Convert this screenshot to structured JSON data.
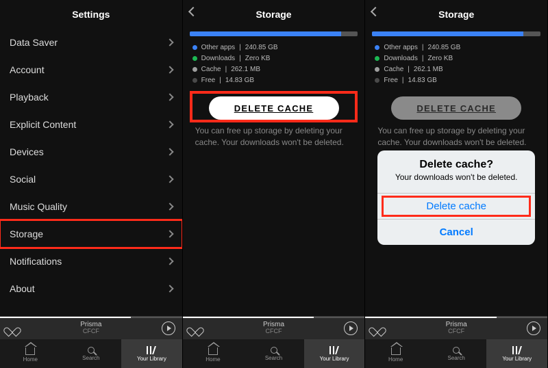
{
  "colors": {
    "highlight": "#ff2b1a",
    "link": "#007aff",
    "barBlue": "#3b82f6",
    "dotBlue": "#3b82f6",
    "dotGreen": "#1db954",
    "dotGray": "#9e9e9e",
    "dotDark": "#4a4a4a"
  },
  "settings": {
    "title": "Settings",
    "items": [
      {
        "label": "Data Saver"
      },
      {
        "label": "Account"
      },
      {
        "label": "Playback"
      },
      {
        "label": "Explicit Content"
      },
      {
        "label": "Devices"
      },
      {
        "label": "Social"
      },
      {
        "label": "Music Quality"
      },
      {
        "label": "Storage",
        "highlighted": true
      },
      {
        "label": "Notifications"
      },
      {
        "label": "About"
      }
    ]
  },
  "storage": {
    "title": "Storage",
    "bar_fill_percent": 90,
    "legend": [
      {
        "color": "dotBlue",
        "label": "Other apps",
        "value": "240.85 GB"
      },
      {
        "color": "dotGreen",
        "label": "Downloads",
        "value": "Zero KB"
      },
      {
        "color": "dotGray",
        "label": "Cache",
        "value": "262.1 MB"
      },
      {
        "color": "dotDark",
        "label": "Free",
        "value": "14.83 GB"
      }
    ],
    "delete_button": "DELETE CACHE",
    "info_text": "You can free up storage by deleting your cache. Your downloads won't be deleted."
  },
  "dialog": {
    "title": "Delete cache?",
    "message": "Your downloads won't be deleted.",
    "confirm": "Delete cache",
    "cancel": "Cancel"
  },
  "now_playing": {
    "track": "Prisma",
    "artist": "CFCF",
    "progress_percent": 72
  },
  "tabs": {
    "items": [
      {
        "label": "Home"
      },
      {
        "label": "Search"
      },
      {
        "label": "Your Library",
        "active": true
      }
    ]
  }
}
